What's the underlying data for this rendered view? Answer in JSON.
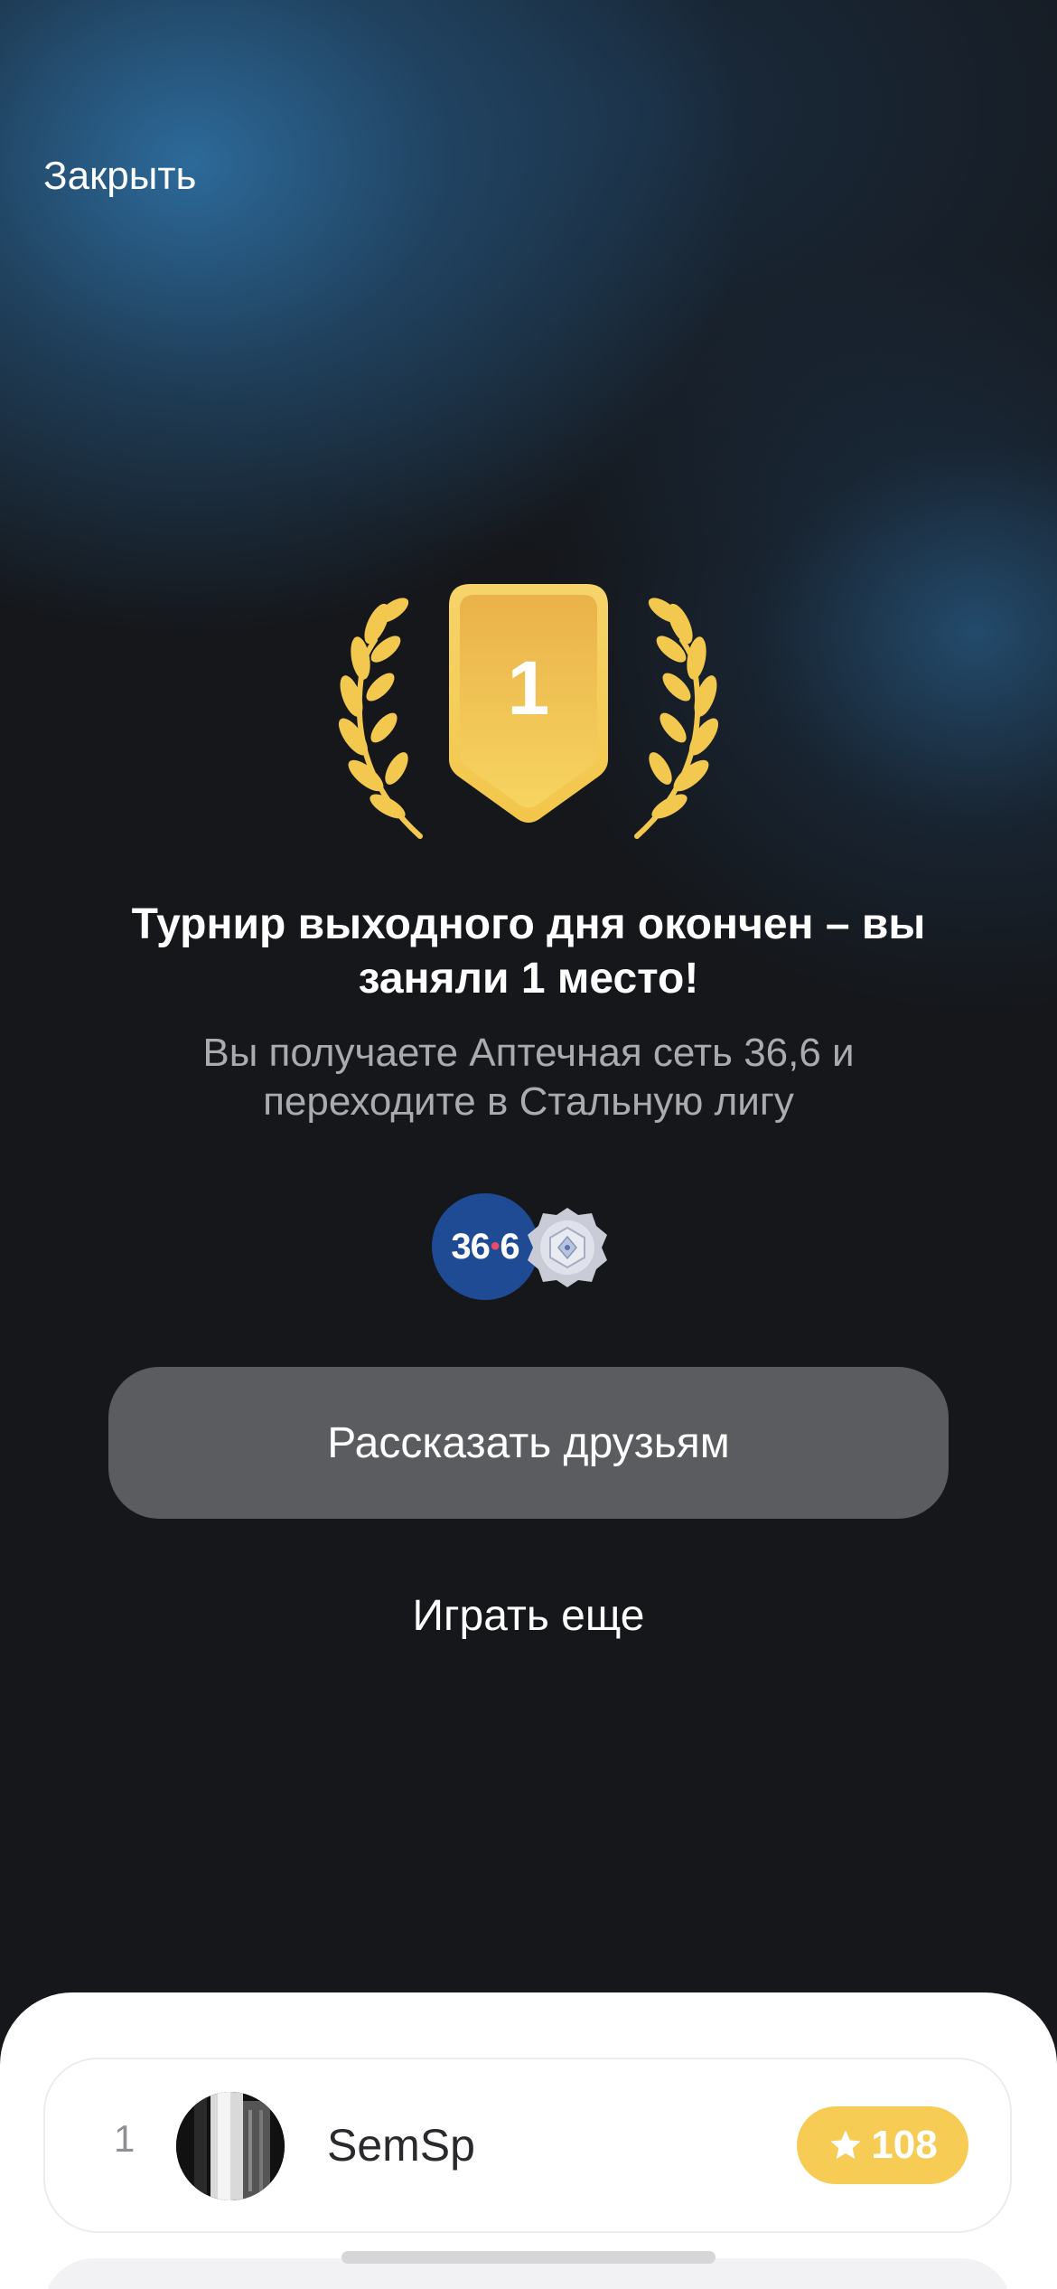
{
  "header": {
    "close_label": "Закрыть"
  },
  "result": {
    "place_number": "1",
    "title": "Турнир выходного дня окончен – вы заняли 1 место!",
    "subtitle": "Вы получаете Аптечная сеть 36,6 и переходите в Стальную лигу",
    "reward_logo_left": "36",
    "reward_logo_dot": "•",
    "reward_logo_right": "6",
    "league_badge_icon": "steel-league-badge-icon"
  },
  "actions": {
    "share_label": "Рассказать друзьям",
    "play_again_label": "Играть еще"
  },
  "leaderboard": {
    "rows": [
      {
        "rank": "1",
        "username": "SemSp",
        "score": "108",
        "score_icon": "star-icon"
      }
    ]
  },
  "colors": {
    "gold": "#f6cc55",
    "share_button_bg": "#5b5c60",
    "background_dark": "#15171b",
    "background_blue": "#2e6ea0",
    "reward_logo_bg": "#1f4b95"
  }
}
